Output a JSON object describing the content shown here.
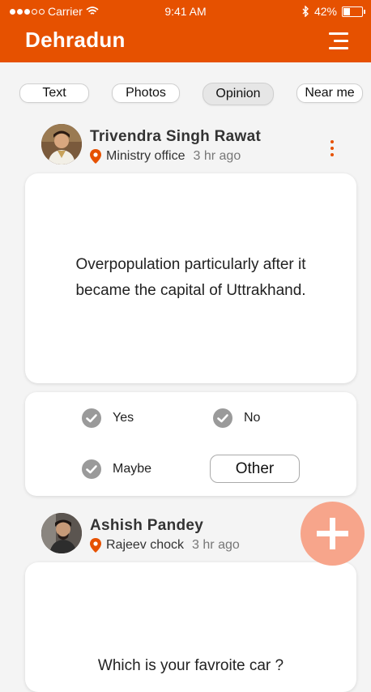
{
  "status_bar": {
    "carrier": "Carrier",
    "time": "9:41 AM",
    "battery": "42%",
    "battery_level": 0.42
  },
  "header": {
    "title": "Dehradun",
    "menu_icon": "hamburger-menu-icon"
  },
  "tabs": [
    {
      "label": "Text"
    },
    {
      "label": "Photos"
    },
    {
      "label": "Opinion",
      "active": true
    },
    {
      "label": "Near me"
    }
  ],
  "posts": [
    {
      "author": "Trivendra Singh Rawat",
      "location": "Ministry office",
      "time": "3 hr ago",
      "question_line1": "Overpopulation particularly after it",
      "question_line2": "became the capital of Uttrakhand.",
      "options": {
        "yes": "Yes",
        "no": "No",
        "maybe": "Maybe",
        "other": "Other"
      }
    },
    {
      "author": "Ashish Pandey",
      "location": "Rajeev chock",
      "time": "3 hr ago",
      "question_line1": "Which is your favroite car ?"
    }
  ],
  "colors": {
    "brand": "#e65100",
    "fab": "#f7a58b"
  }
}
